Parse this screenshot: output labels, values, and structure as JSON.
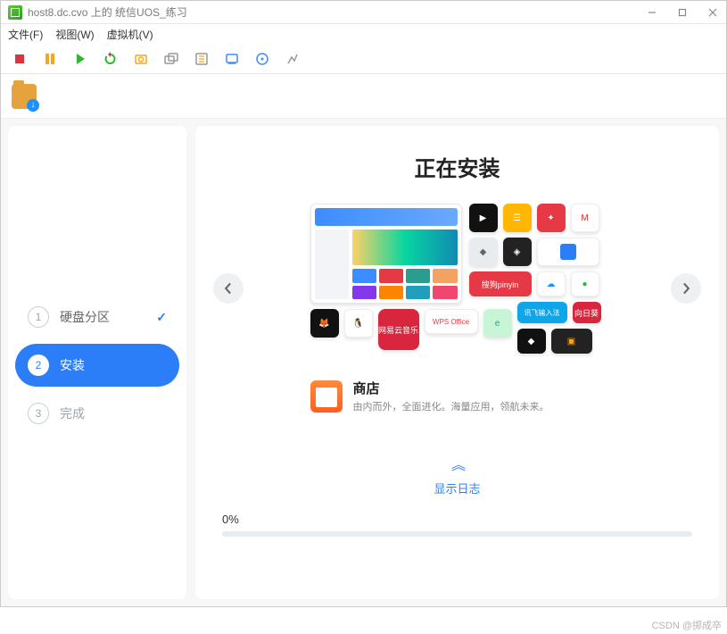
{
  "titlebar": {
    "title": "host8.dc.cvo 上的 统信UOS_练习"
  },
  "menubar": {
    "file": "文件(F)",
    "view": "视图(W)",
    "vm": "虚拟机(V)"
  },
  "steps": {
    "s1": {
      "num": "1",
      "label": "硬盘分区",
      "check": "✓"
    },
    "s2": {
      "num": "2",
      "label": "安装"
    },
    "s3": {
      "num": "3",
      "label": "完成"
    }
  },
  "installer": {
    "heading": "正在安装",
    "shop_title": "商店",
    "shop_subtitle": "由内而外，全面进化。海量应用，领航未来。",
    "show_log": "显示日志",
    "progress_text": "0%"
  },
  "watermark": "CSDN @掷成卒"
}
